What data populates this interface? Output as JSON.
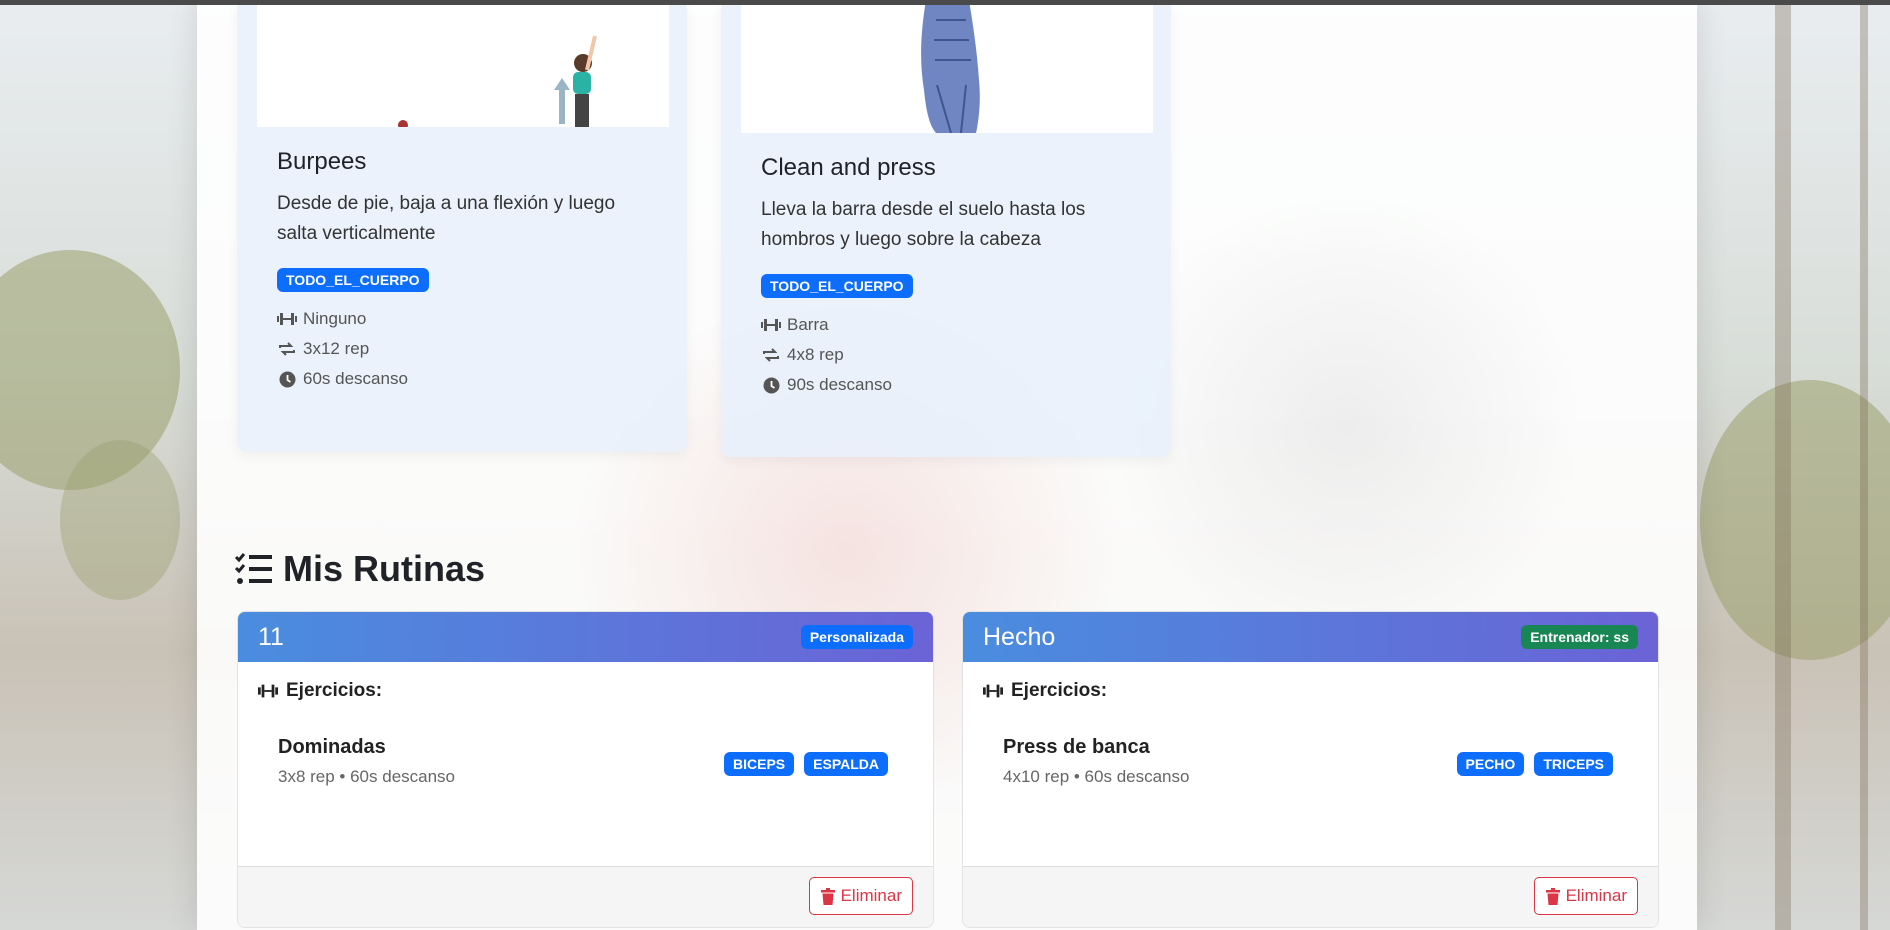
{
  "colors": {
    "accent": "#0d6efd",
    "success": "#198754",
    "danger": "#dc3545"
  },
  "exercises": [
    {
      "title": "Burpees",
      "description": "Desde de pie, baja a una flexión y luego salta verticalmente",
      "tag": "TODO_EL_CUERPO",
      "equipment": "Ninguno",
      "sets": "3x12 rep",
      "rest": "60s descanso"
    },
    {
      "title": "Clean and press",
      "description": "Lleva la barra desde el suelo hasta los hombros y luego sobre la cabeza",
      "tag": "TODO_EL_CUERPO",
      "equipment": "Barra",
      "sets": "4x8 rep",
      "rest": "90s descanso"
    }
  ],
  "section": {
    "title": "Mis Rutinas",
    "icon": "list-check-icon"
  },
  "routines": [
    {
      "name": "11",
      "badge": "Personalizada",
      "subtitle": "Ejercicios:",
      "exercise_name": "Dominadas",
      "exercise_meta": "3x8 rep • 60s descanso",
      "tags": [
        "BICEPS",
        "ESPALDA"
      ],
      "delete_label": "Eliminar"
    },
    {
      "name": "Hecho",
      "badge": "Entrenador: ss",
      "subtitle": "Ejercicios:",
      "exercise_name": "Press de banca",
      "exercise_meta": "4x10 rep • 60s descanso",
      "tags": [
        "PECHO",
        "TRICEPS"
      ],
      "delete_label": "Eliminar"
    }
  ]
}
